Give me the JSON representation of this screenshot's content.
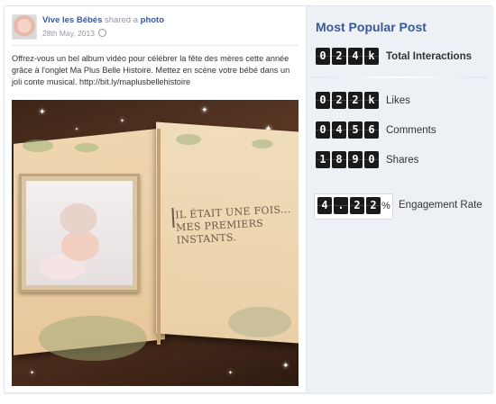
{
  "post": {
    "author": "Vive les Bébés",
    "action": "shared a",
    "object": "photo",
    "date": "28th May, 2013",
    "text": "Offrez-vous un bel album vidéo pour célébrer la fête des mères cette année grâce à l'onglet Ma Plus Belle Histoire. Mettez en scène votre bébé dans un joli conte musical. http://bit.ly/maplusbellehistoire",
    "image_caption_line1": "IL ÉTAIT UNE FOIS...",
    "image_caption_line2": "MES PREMIERS INSTANTS."
  },
  "stats": {
    "title": "Most Popular Post",
    "total_interactions": {
      "digits": [
        "0",
        "2",
        "4",
        "k"
      ],
      "label": "Total Interactions"
    },
    "likes": {
      "digits": [
        "0",
        "2",
        "2",
        "k"
      ],
      "label": "Likes"
    },
    "comments": {
      "digits": [
        "0",
        "4",
        "5",
        "6"
      ],
      "label": "Comments"
    },
    "shares": {
      "digits": [
        "1",
        "8",
        "9",
        "0"
      ],
      "label": "Shares"
    },
    "engagement": {
      "digits": [
        "4",
        ".",
        "2",
        "2"
      ],
      "suffix": "%",
      "label": "Engagement Rate"
    }
  },
  "colors": {
    "link": "#3b5998",
    "panel": "#edf0f5",
    "digit_bg": "#1a1a1a"
  },
  "icons": {
    "privacy": "globe-icon"
  }
}
